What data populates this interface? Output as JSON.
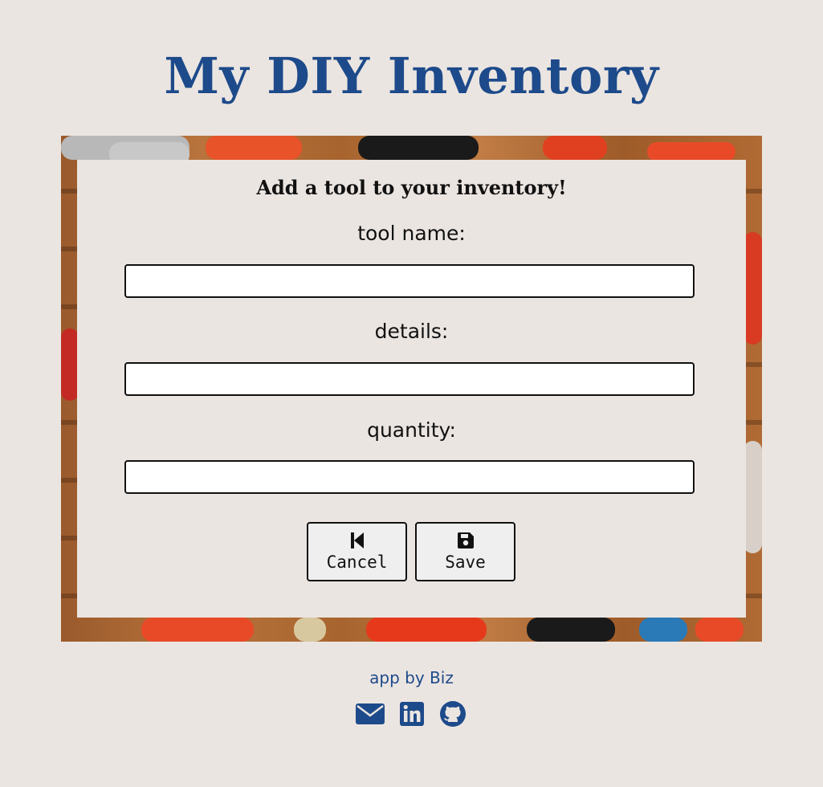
{
  "app": {
    "title": "My DIY Inventory"
  },
  "form": {
    "heading": "Add a tool to your inventory!",
    "fields": [
      {
        "label": "tool name:",
        "value": "",
        "placeholder": ""
      },
      {
        "label": "details:",
        "value": "",
        "placeholder": ""
      },
      {
        "label": "quantity:",
        "value": "",
        "placeholder": ""
      }
    ],
    "cancel": {
      "label": "Cancel",
      "icon": "step-backward-icon"
    },
    "save": {
      "label": "Save",
      "icon": "floppy-disk-icon"
    }
  },
  "footer": {
    "credit": "app by Biz",
    "links": [
      {
        "icon": "envelope-icon"
      },
      {
        "icon": "linkedin-icon"
      },
      {
        "icon": "github-icon"
      }
    ]
  },
  "colors": {
    "brand": "#1d4a8a",
    "background": "#ebe5e1",
    "card": "#ebe5e1",
    "border": "#111111"
  }
}
